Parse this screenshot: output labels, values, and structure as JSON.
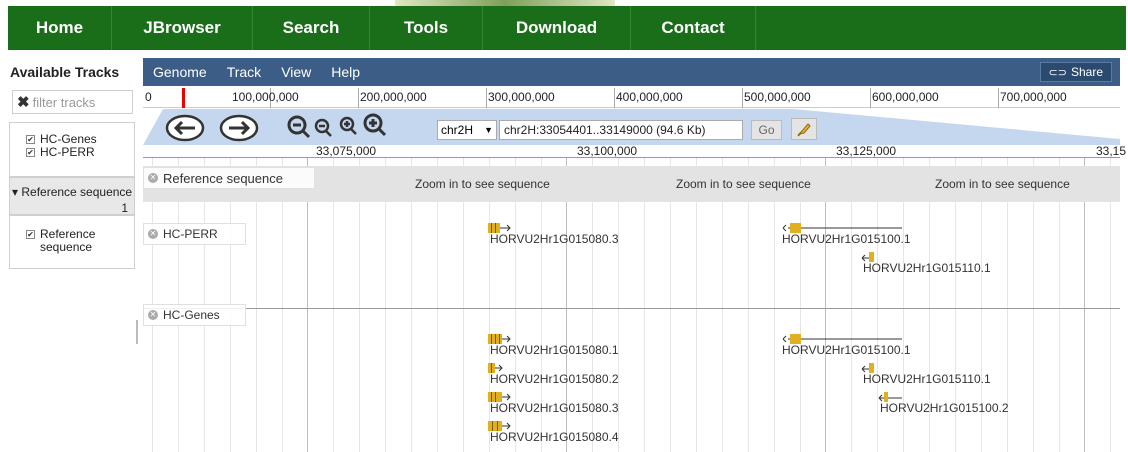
{
  "topnav": {
    "items": [
      {
        "label": "Home",
        "width": 104
      },
      {
        "label": "JBrowser",
        "width": 141
      },
      {
        "label": "Search",
        "width": 117
      },
      {
        "label": "Tools",
        "width": 113
      },
      {
        "label": "Download",
        "width": 148
      },
      {
        "label": "Contact",
        "width": 125
      }
    ]
  },
  "sidebar": {
    "title": "Available Tracks",
    "filter_placeholder": "filter tracks",
    "group1_tracks": [
      "HC-Genes",
      "HC-PERR"
    ],
    "ref_category": "▾ Reference sequence",
    "ref_count": "1",
    "group2_tracks": [
      "Reference sequence"
    ]
  },
  "menubar": {
    "items": [
      "Genome",
      "Track",
      "View",
      "Help"
    ],
    "share_label": "Share"
  },
  "overview": {
    "ticks": [
      "0",
      "100,000,000",
      "200,000,000",
      "300,000,000",
      "400,000,000",
      "500,000,000",
      "600,000,000",
      "700,000,000"
    ]
  },
  "navigation": {
    "chromosome": "chr2H",
    "location": "chr2H:33054401..33149000 (94.6 Kb)",
    "go_label": "Go"
  },
  "scale": {
    "ticks": [
      "33,075,000",
      "33,100,000",
      "33,125,000",
      "33,15"
    ]
  },
  "tracks": {
    "reference": {
      "label": "Reference sequence",
      "label_ghost": "Reference sequence",
      "zoom_message": "Zoom in to see sequence"
    },
    "perr": {
      "label": "HC-PERR",
      "features": [
        "HORVU2Hr1G015080.3",
        "HORVU2Hr1G015100.1",
        "HORVU2Hr1G015110.1"
      ]
    },
    "genes": {
      "label": "HC-Genes",
      "features": [
        "HORVU2Hr1G015080.1",
        "HORVU2Hr1G015080.2",
        "HORVU2Hr1G015080.3",
        "HORVU2Hr1G015080.4",
        "HORVU2Hr1G015100.1",
        "HORVU2Hr1G015110.1",
        "HORVU2Hr1G015100.2"
      ]
    }
  },
  "colors": {
    "nav_green": "#1a6e1a",
    "menubar_blue": "#3b5d86",
    "feature_gold": "#e0b020"
  }
}
